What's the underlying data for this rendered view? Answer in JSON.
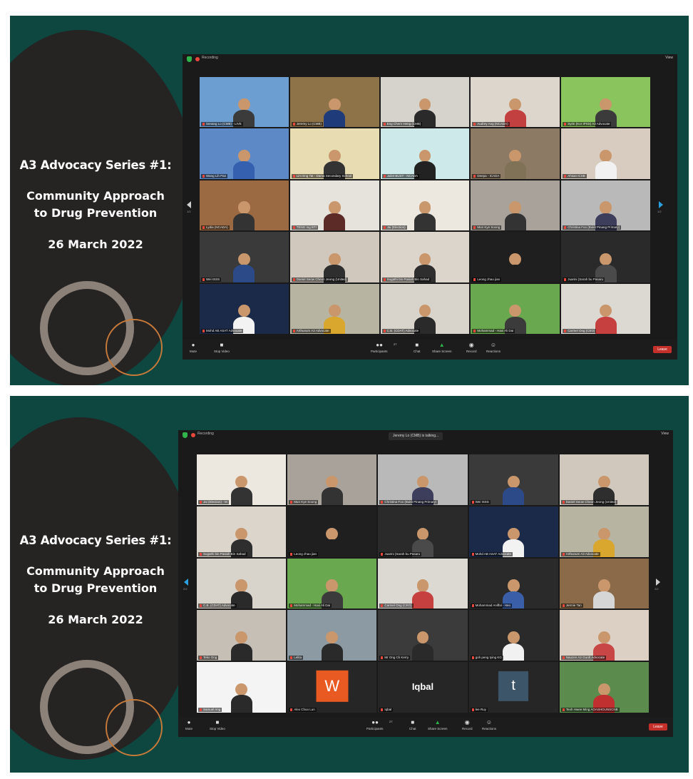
{
  "slides": [
    {
      "title": "A3 Advocacy Series #1:",
      "subtitle": "Community Approach\nto Drug Prevention",
      "date": "26 March 2022",
      "zoom": {
        "recording_label": "Recording",
        "view_label": "View",
        "talking_label": "",
        "page_left": "1/2",
        "page_right": "1/2",
        "controls": {
          "mute": "Mute",
          "video": "Stop Video",
          "participants": "Participants",
          "participants_count": "27",
          "chat": "Chat",
          "share": "Share Screen",
          "record": "Record",
          "reactions": "Reactions",
          "leave": "Leave"
        },
        "participants": [
          {
            "name": "Senang Lo (CMB) - LIVE",
            "bg": "#6c9ed2",
            "shirt": "#3b3b3b"
          },
          {
            "name": "Jeremy Lo (CMB)",
            "bg": "#8e7348",
            "shirt": "#1f3b79"
          },
          {
            "name": "Eng Chern Heng (CMB)",
            "bg": "#d6d3cd",
            "shirt": "#2a2a2a"
          },
          {
            "name": "Audrey Ang (NCADA)",
            "bg": "#dcd6cd",
            "shirt": "#c34040"
          },
          {
            "name": "Syrin (Kor IPSS) A3 Advocate",
            "bg": "#89c45d",
            "shirt": "#3b3b3b"
          },
          {
            "name": "Wang Lih Pan",
            "bg": "#5d89c6",
            "shirt": "#3560b0"
          },
          {
            "name": "Lim Eng Tat - Dama Secondary School",
            "bg": "#e8dcb2",
            "shirt": "#333333"
          },
          {
            "name": "Juliet BUST - NCADA",
            "bg": "#cde9ea",
            "shirt": "#222222"
          },
          {
            "name": "Deepa - ICADA",
            "bg": "#8d7a64",
            "shirt": "#807256"
          },
          {
            "name": "Ahsan ICSB",
            "bg": "#d8cbbf",
            "shirt": "#f1f1f1"
          },
          {
            "name": "Lydia (NCADA)",
            "bg": "#9b6a43",
            "shirt": "#333333"
          },
          {
            "name": "TENG Ing BTI",
            "bg": "#e6e2dc",
            "shirt": "#5c2b28"
          },
          {
            "name": "Jai (Election)",
            "bg": "#ece8e0",
            "shirt": "#333333"
          },
          {
            "name": "Mun Kye Soong",
            "bg": "#a8a29a",
            "shirt": "#333333"
          },
          {
            "name": "Christina Foo (Bukit Pinang Primary)",
            "bg": "#b9b9b9",
            "shirt": "#3d3d5c"
          },
          {
            "name": "Wei ISSS",
            "bg": "#3a3a3a",
            "shirt": "#2d4a88"
          },
          {
            "name": "Daniel Seow Cheon Jeong (United)",
            "bg": "#d0c8bd",
            "shirt": "#2e2e2e"
          },
          {
            "name": "Sugathi bin Pasiah Bin Sahad",
            "bg": "#dcd5cc",
            "shirt": "#2e2e2e"
          },
          {
            "name": "Leong zhao jian",
            "bg": "#1f1f1f",
            "shirt": "#1f1f1f"
          },
          {
            "name": "Juarini (Sarah bu Pasaru",
            "bg": "#2a2a2a",
            "shirt": "#4a4a4a"
          },
          {
            "name": "Mohd AB ASAT Advocate",
            "bg": "#1c2a4a",
            "shirt": "#f2f2f2"
          },
          {
            "name": "Arthunum A3 Advocate",
            "bg": "#b7b4a2",
            "shirt": "#d9a72e"
          },
          {
            "name": "C.B. (CDAT) Advocate",
            "bg": "#d9d4cb",
            "shirt": "#2a2a2a"
          },
          {
            "name": "Mohammad - Haxi Ali Dai",
            "bg": "#6aa84f",
            "shirt": "#3b3b3b"
          },
          {
            "name": "Carmel Ong (CEO)",
            "bg": "#dcd8d2",
            "shirt": "#c74040"
          }
        ]
      }
    },
    {
      "title": "A3 Advocacy Series #1:",
      "subtitle": "Community Approach\nto Drug Prevention",
      "date": "26 March 2022",
      "zoom": {
        "recording_label": "Recording",
        "view_label": "View",
        "talking_label": "Jeremy Lo (CMB) is talking...",
        "page_left": "2/2",
        "page_right": "2/2",
        "controls": {
          "mute": "Mute",
          "video": "Stop Video",
          "participants": "Participants",
          "participants_count": "27",
          "chat": "Chat",
          "share": "Share Screen",
          "record": "Record",
          "reactions": "Reactions",
          "leave": "Leave"
        },
        "participants": [
          {
            "name": "Jai (Election) - M",
            "bg": "#ece8e0",
            "shirt": "#333333"
          },
          {
            "name": "Mun Kye Soong",
            "bg": "#a8a29a",
            "shirt": "#333333"
          },
          {
            "name": "Christina Foo (Bukit Pinang Primary)",
            "bg": "#b9b9b9",
            "shirt": "#3d3d5c"
          },
          {
            "name": "Wei ISSS",
            "bg": "#3a3a3a",
            "shirt": "#2d4a88"
          },
          {
            "name": "Daniel Seow Cheon Jeong (United)",
            "bg": "#d0c8bd",
            "shirt": "#2e2e2e"
          },
          {
            "name": "Sugathi bin Pasiah Bin Sahad",
            "bg": "#dcd5cc",
            "shirt": "#2e2e2e"
          },
          {
            "name": "Leong zhao jian",
            "bg": "#1f1f1f",
            "shirt": "#1f1f1f"
          },
          {
            "name": "Juarini (Sarah bu Pasaru",
            "bg": "#2a2a2a",
            "shirt": "#4a4a4a"
          },
          {
            "name": "Mohd AB ASAT Advocate",
            "bg": "#1c2a4a",
            "shirt": "#f2f2f2"
          },
          {
            "name": "Arthunum A3 Advocate",
            "bg": "#b7b4a2",
            "shirt": "#d9a72e"
          },
          {
            "name": "C.B. (CDAT) Advocate",
            "bg": "#d9d4cb",
            "shirt": "#2a2a2a"
          },
          {
            "name": "Mohammad - Haxi Ali Dai",
            "bg": "#6aa84f",
            "shirt": "#3b3b3b"
          },
          {
            "name": "Carmel Ong (CEO)",
            "bg": "#dcd8d2",
            "shirt": "#c74040"
          },
          {
            "name": "Mohammad Aniffal - Heo",
            "bg": "#2a2a2a",
            "shirt": "#3b5ea8"
          },
          {
            "name": "Jermie Tan",
            "bg": "#8a6a48",
            "shirt": "#d6d6d6"
          },
          {
            "name": "Teko Ong",
            "bg": "#c6bfb5",
            "shirt": "#2a2a2a"
          },
          {
            "name": "Lelita",
            "bg": "#8c9aa3",
            "shirt": "#2a2a2a"
          },
          {
            "name": "Mr Ong Ck Kerry",
            "bg": "#3b3b3b",
            "shirt": "#2a2a2a"
          },
          {
            "name": "goh peng tying KG",
            "bg": "#2a2a2a",
            "shirt": "#f1f1f1"
          },
          {
            "name": "Nauzen A3 Gurdt Advocate",
            "bg": "#dcd0c4",
            "shirt": "#c94646"
          },
          {
            "name": "Samuel Ang",
            "bg": "#f4f4f4",
            "shirt": "#2a2a2a"
          },
          {
            "name": "Alex Choo Lun",
            "bg": "#262626",
            "shirt": "#262626",
            "avatar": "W",
            "avatar_color": "#e85a21"
          },
          {
            "name": "Iqbal",
            "bg": "#262626",
            "shirt": "#262626",
            "avatar_text": "Iqbal"
          },
          {
            "name": "lee Ruy",
            "bg": "#262626",
            "shirt": "#262626",
            "avatar": "t",
            "avatar_color": "#3d5568"
          },
          {
            "name": "Teoh Hwee Ming AOASHOUNSCNB",
            "bg": "#5b8c4e",
            "shirt": "#c03030"
          }
        ]
      }
    }
  ]
}
